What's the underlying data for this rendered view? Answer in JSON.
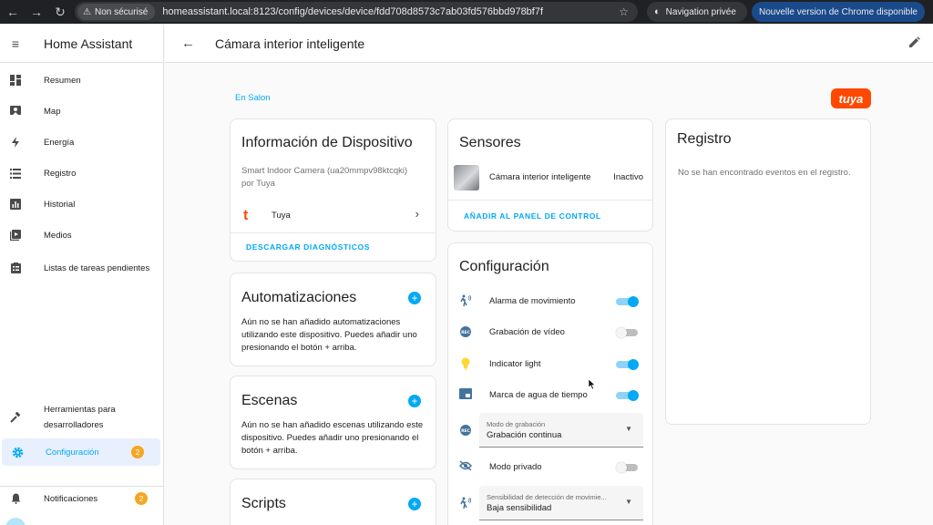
{
  "browser": {
    "security_label": "Non sécurisé",
    "url": "homeassistant.local:8123/config/devices/device/fdd708d8573c7ab03fd576bbd978bf7f",
    "private_label": "Navigation privée",
    "update_label": "Nouvelle version de Chrome disponible"
  },
  "sidebar": {
    "title": "Home Assistant",
    "items": [
      {
        "label": "Resumen",
        "icon": "dashboard-icon"
      },
      {
        "label": "Map",
        "icon": "map-icon"
      },
      {
        "label": "Energía",
        "icon": "lightning-icon"
      },
      {
        "label": "Registro",
        "icon": "list-icon"
      },
      {
        "label": "Historial",
        "icon": "chart-icon"
      },
      {
        "label": "Medios",
        "icon": "media-icon"
      },
      {
        "label": "Listas de tareas pendientes",
        "icon": "clipboard-icon"
      }
    ],
    "dev_tools_line1": "Herramientas para",
    "dev_tools_line2": "desarrolladores",
    "config_label": "Configuración",
    "config_badge": "2",
    "notifications_label": "Notificaciones",
    "notifications_badge": "2"
  },
  "header": {
    "title": "Cámara interior inteligente"
  },
  "area_link": "En Salon",
  "brand_logo_text": "tuya",
  "device_info": {
    "title": "Información de Dispositivo",
    "model": "Smart Indoor Camera (ua20mmpv98ktcqki)",
    "manufacturer": "por Tuya",
    "integration": "Tuya",
    "download_label": "DESCARGAR DIAGNÓSTICOS"
  },
  "automations": {
    "title": "Automatizaciones",
    "text": "Aún no se han añadido automatizaciones utilizando este dispositivo. Puedes añadir uno presionando el botón + arriba."
  },
  "scenes": {
    "title": "Escenas",
    "text": "Aún no se han añadido escenas utilizando este dispositivo. Puedes añadir uno presionando el botón + arriba."
  },
  "scripts": {
    "title": "Scripts"
  },
  "sensors": {
    "title": "Sensores",
    "entity_name": "Cámara interior inteligente",
    "entity_state": "Inactivo",
    "add_label": "AÑADIR AL PANEL DE CONTROL"
  },
  "configuration": {
    "title": "Configuración",
    "rows": [
      {
        "label": "Alarma de movimiento",
        "state": "on",
        "icon": "motion-icon"
      },
      {
        "label": "Grabación de vídeo",
        "state": "off",
        "icon": "rec-icon"
      },
      {
        "label": "Indicator light",
        "state": "on",
        "icon": "lightbulb-icon"
      },
      {
        "label": "Marca de agua de tiempo",
        "state": "on",
        "icon": "watermark-icon"
      }
    ],
    "record_mode_label": "Modo de grabación",
    "record_mode_value": "Grabación continua",
    "privacy_label": "Modo privado",
    "privacy_state": "off",
    "sensitivity_label": "Sensibilidad de detección de movimie...",
    "sensitivity_value": "Baja sensibilidad"
  },
  "log": {
    "title": "Registro",
    "empty_text": "No se han encontrado eventos en el registro."
  },
  "colors": {
    "accent": "#03a9f4",
    "badge": "#f5a623",
    "tuya": "#ff4800"
  }
}
